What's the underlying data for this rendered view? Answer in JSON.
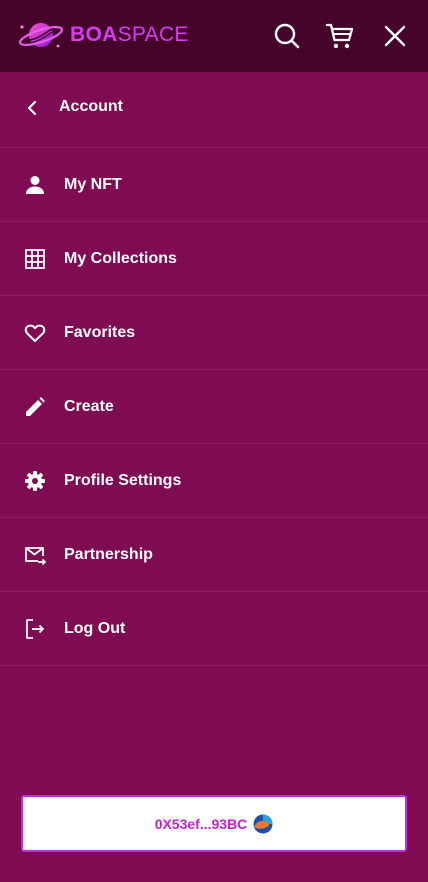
{
  "brand": {
    "name_bold": "BOA",
    "name_light": "SPACE",
    "accent_color": "#d63cf0"
  },
  "header": {
    "icons": [
      "search-icon",
      "cart-icon",
      "close-icon"
    ],
    "background": "#46042b"
  },
  "back": {
    "label": "Account",
    "icon": "chevron-left-icon"
  },
  "menu": {
    "items": [
      {
        "label": "My NFT",
        "icon": "person-icon"
      },
      {
        "label": "My Collections",
        "icon": "grid-icon"
      },
      {
        "label": "Favorites",
        "icon": "heart-icon"
      },
      {
        "label": "Create",
        "icon": "pencil-icon"
      },
      {
        "label": "Profile Settings",
        "icon": "gear-icon"
      },
      {
        "label": "Partnership",
        "icon": "mail-forward-icon"
      },
      {
        "label": "Log Out",
        "icon": "logout-icon"
      }
    ]
  },
  "wallet": {
    "address": "0X53ef...93BC",
    "icon": "coin-icon"
  },
  "colors": {
    "background": "#7f0b52",
    "divider": "#8e1e62",
    "wallet_text": "#c31fd2"
  }
}
